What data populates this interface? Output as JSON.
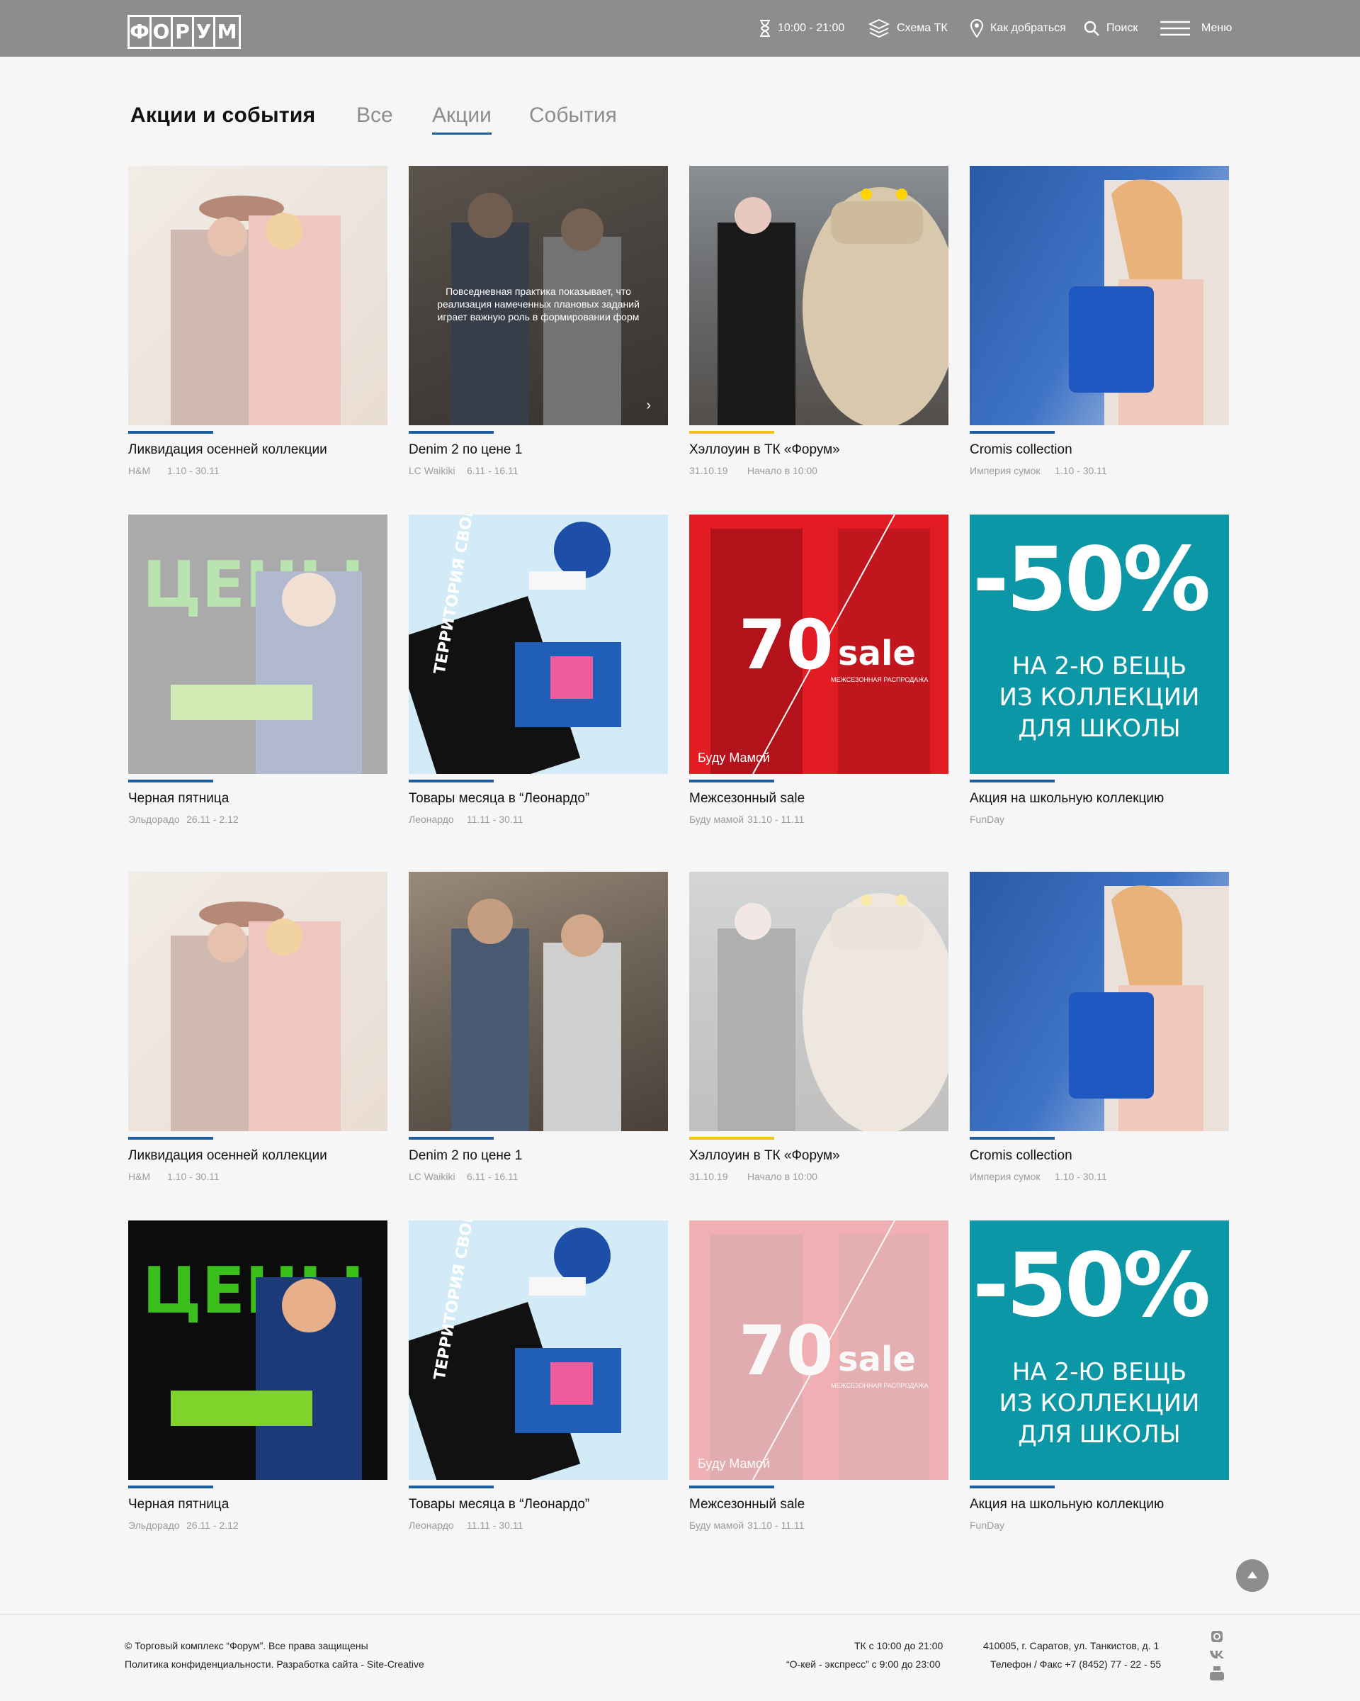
{
  "header": {
    "logo_letters": [
      "Ф",
      "О",
      "Р",
      "У",
      "М"
    ],
    "hours": "10:00 - 21:00",
    "scheme": "Схема ТК",
    "directions": "Как добраться",
    "search": "Поиск",
    "menu": "Меню"
  },
  "page": {
    "title": "Акции и события",
    "tabs": [
      {
        "label": "Все"
      },
      {
        "label": "Акции",
        "active": true
      },
      {
        "label": "События"
      }
    ]
  },
  "cards": [
    {
      "title": "Ликвидация осенней коллекции",
      "store": "H&M",
      "dates": "1.10 - 30.11"
    },
    {
      "title": "Denim 2 по цене 1",
      "store": "LC Waikiki",
      "dates": "6.11 - 16.11",
      "overlay": "Повседневная практика показывает, что реализация намеченных плановых заданий играет важную роль в формировании форм"
    },
    {
      "title": "Хэллоуин в ТК «Форум»",
      "store": "31.10.19",
      "dates": "Начало в 10:00"
    },
    {
      "title": "Cromis collection",
      "store": "Империя сумок",
      "dates": "1.10 - 30.11"
    },
    {
      "title": "Черная пятница",
      "store": "Эльдорадо",
      "dates": "26.11 - 2.12"
    },
    {
      "title": "Товары месяца в “Леонардо”",
      "store": "Леонардо",
      "dates": "11.11 - 30.11"
    },
    {
      "title": "Межсезонный sale",
      "store": "Буду мамой",
      "dates": "31.10 - 11.11"
    },
    {
      "title": "Акция на школьную коллекцию",
      "store": "FunDay",
      "dates": ""
    },
    {
      "title": "Ликвидация осенней коллекции",
      "store": "H&M",
      "dates": "1.10 - 30.11"
    },
    {
      "title": "Denim 2 по цене 1",
      "store": "LC Waikiki",
      "dates": "6.11 - 16.11"
    },
    {
      "title": "Хэллоуин в ТК «Форум»",
      "store": "31.10.19",
      "dates": "Начало в 10:00"
    },
    {
      "title": "Cromis collection",
      "store": "Империя сумок",
      "dates": "1.10 - 30.11"
    },
    {
      "title": "Черная пятница",
      "store": "Эльдорадо",
      "dates": "26.11 - 2.12"
    },
    {
      "title": "Товары месяца в “Леонардо”",
      "store": "Леонардо",
      "dates": "11.11 - 30.11"
    },
    {
      "title": "Межсезонный sale",
      "store": "Буду мамой",
      "dates": "31.10 - 11.11"
    },
    {
      "title": "Акция на школьную коллекцию",
      "store": "FunDay",
      "dates": ""
    }
  ],
  "promo_art": {
    "discount": "-50%",
    "discount_lines": [
      "НА 2-Ю ВЕЩЬ",
      "ИЗ КОЛЛЕКЦИИ",
      "ДЛЯ ШКОЛЫ"
    ],
    "sale_number": "70",
    "sale_word": "sale",
    "sale_subtitle": "МЕЖСЕЗОННАЯ РАСПРОДАЖА",
    "sale_brand": "Буду Мамой",
    "tote_text": "ТЕРРИТОРИЯ СВОБОДНЫХ ИДЕЙ",
    "price_word": "ЦЕНЫ"
  },
  "footer": {
    "copyright": "© Торговый комплекс “Форум”. Все права защищены",
    "links": "Политика конфиденциальности. Разработка сайта - Site-Creative",
    "hours_main": "ТК с 10:00 до 21:00",
    "hours_express": "“О-кей - экспресс” с 9:00 до 23:00",
    "address": "410005, г. Саратов, ул. Танкистов, д. 1",
    "phone": "Телефон / Факс +7 (8452) 77 - 22 - 55"
  },
  "colors": {
    "header_bg": "#8e8c8c",
    "accent": "#1f5e9c",
    "event_accent": "#f3c31a"
  }
}
